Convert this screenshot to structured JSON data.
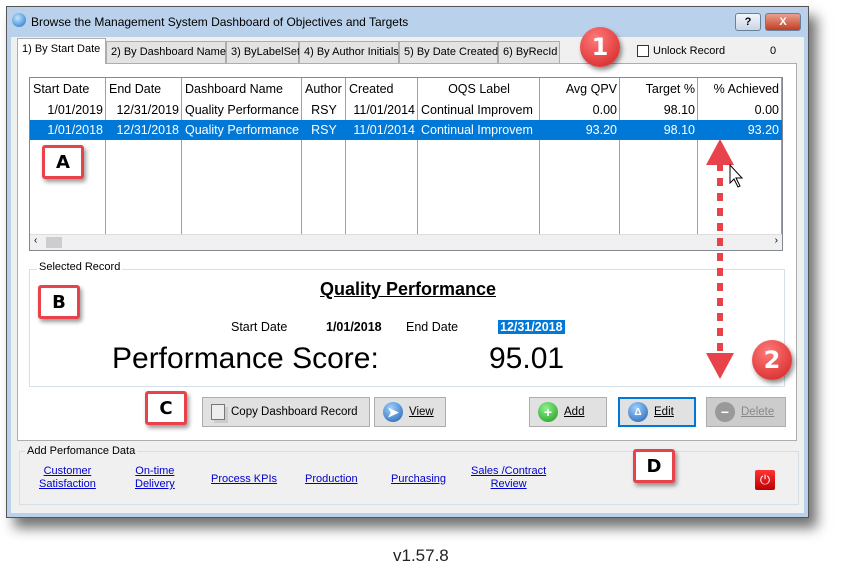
{
  "window": {
    "title": "Browse the Management System Dashboard of Objectives and Targets",
    "help": "?",
    "close": "X"
  },
  "tabs": [
    "1) By Start Date",
    "2) By Dashboard Name",
    "3) ByLabelSet",
    "4) By Author Initials",
    "5) By Date Created",
    "6) ByRecId"
  ],
  "unlock": {
    "label": "Unlock Record",
    "checked": false,
    "count": "0"
  },
  "grid": {
    "columns": [
      "Start Date",
      "End Date",
      "Dashboard Name",
      "Author",
      "Created",
      "OQS Label",
      "Avg QPV",
      "Target %",
      "% Achieved"
    ],
    "rows": [
      [
        "1/01/2019",
        "12/31/2019",
        "Quality Performance",
        "RSY",
        "11/01/2014",
        "Continual Improvem",
        "0.00",
        "98.10",
        "0.00"
      ],
      [
        "1/01/2018",
        "12/31/2018",
        "Quality Performance",
        "RSY",
        "11/01/2014",
        "Continual Improvem",
        "93.20",
        "98.10",
        "93.20"
      ]
    ],
    "selected_row": 1
  },
  "selected": {
    "group": "Selected Record",
    "name": "Quality Performance",
    "start_label": "Start Date",
    "start": "1/01/2018",
    "end_label": "End Date",
    "end": "12/31/2018",
    "score_label": "Performance Score:",
    "score": "95.01"
  },
  "buttons": {
    "copy": "Copy Dashboard Record",
    "view": "View",
    "add": "Add",
    "edit": "Edit",
    "delete": "Delete"
  },
  "perf": {
    "group": "Add Perfomance Data",
    "links": [
      [
        "Customer",
        "Satisfaction"
      ],
      [
        "On-time",
        "Delivery"
      ],
      [
        "Process KPIs"
      ],
      [
        "Production"
      ],
      [
        "Purchasing"
      ],
      [
        "Sales /Contract",
        "Review"
      ]
    ]
  },
  "annotations": {
    "A": "A",
    "B": "B",
    "C": "C",
    "D": "D",
    "one": "1",
    "two": "2"
  },
  "version": "v1.57.8",
  "colors": {
    "selection": "#0078d7",
    "annotation": "#e8434b",
    "link": "#0000cc"
  }
}
